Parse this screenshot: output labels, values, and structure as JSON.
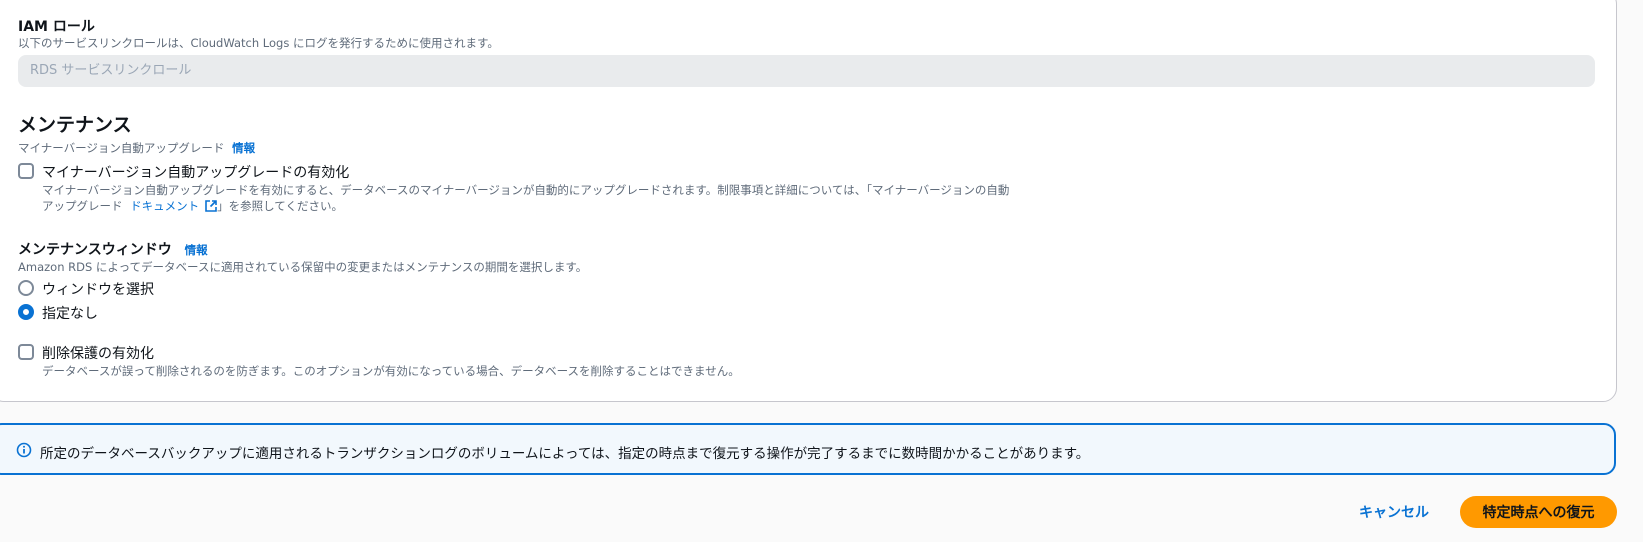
{
  "iam": {
    "label": "IAM ロール",
    "description": "以下のサービスリンクロールは、CloudWatch Logs にログを発行するために使用されます。",
    "placeholder": "RDS サービスリンクロール"
  },
  "maintenance": {
    "title": "メンテナンス",
    "auto_upgrade_label": "マイナーバージョン自動アップグレード",
    "info_link": "情報",
    "checkbox_label": "マイナーバージョン自動アップグレードの有効化",
    "checkbox_checked": false,
    "checkbox_desc_line1": "マイナーバージョン自動アップグレードを有効にすると、データベースのマイナーバージョンが自動的にアップグレードされます。制限事項と詳細については、「マイナーバージョンの自動",
    "checkbox_desc_line2_prefix": "アップグレード",
    "doc_link": "ドキュメント",
    "checkbox_desc_line2_suffix": "」を参照してください。"
  },
  "window": {
    "title": "メンテナンスウィンドウ",
    "info_link": "情報",
    "description": "Amazon RDS によってデータベースに適用されている保留中の変更またはメンテナンスの期間を選択します。",
    "options": [
      {
        "label": "ウィンドウを選択",
        "selected": false
      },
      {
        "label": "指定なし",
        "selected": true
      }
    ]
  },
  "deletion_protection": {
    "label": "削除保護の有効化",
    "checked": false,
    "description": "データベースが誤って削除されるのを防ぎます。このオプションが有効になっている場合、データベースを削除することはできません。"
  },
  "alert": {
    "text": "所定のデータベースバックアップに適用されるトランザクションログのボリュームによっては、指定の時点まで復元する操作が完了するまでに数時間かかることがあります。",
    "icon": "info-icon"
  },
  "footer": {
    "cancel_label": "キャンセル",
    "submit_label": "特定時点への復元"
  },
  "colors": {
    "accent": "#0972d3",
    "primary_button": "#ff9900",
    "alert_bg": "#f2f8fd"
  }
}
